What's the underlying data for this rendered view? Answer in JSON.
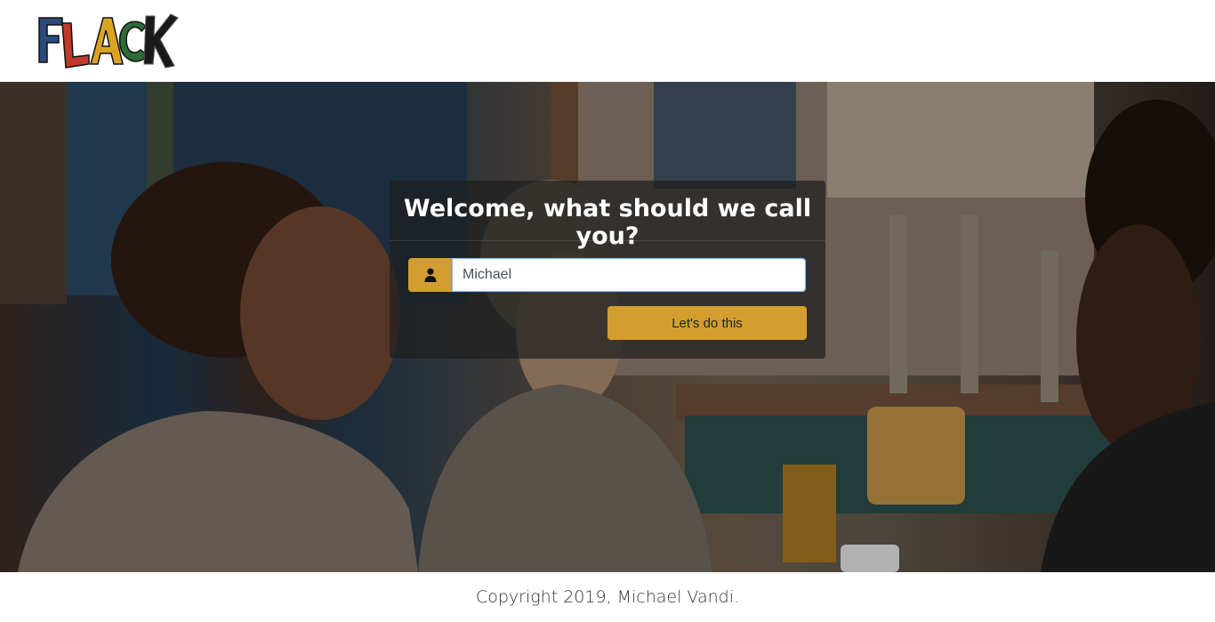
{
  "brand": {
    "logo_text": "FLACK",
    "logo_letters": [
      "F",
      "L",
      "A",
      "C",
      "K"
    ]
  },
  "icons": {
    "user": "user-icon"
  },
  "login": {
    "heading": "Welcome, what should we call you?",
    "name_value": "Michael",
    "submit_label": "Let's do this"
  },
  "footer": {
    "copyright": "Copyright 2019, Michael Vandi."
  },
  "colors": {
    "accent": "#d39e2f",
    "card_bg": "rgba(30,30,30,0.72)",
    "logo_blue": "#2b4a7a",
    "logo_red": "#c0392b",
    "logo_yellow": "#d9a520",
    "logo_green": "#2e6b3a",
    "logo_black": "#1a1a1a"
  }
}
